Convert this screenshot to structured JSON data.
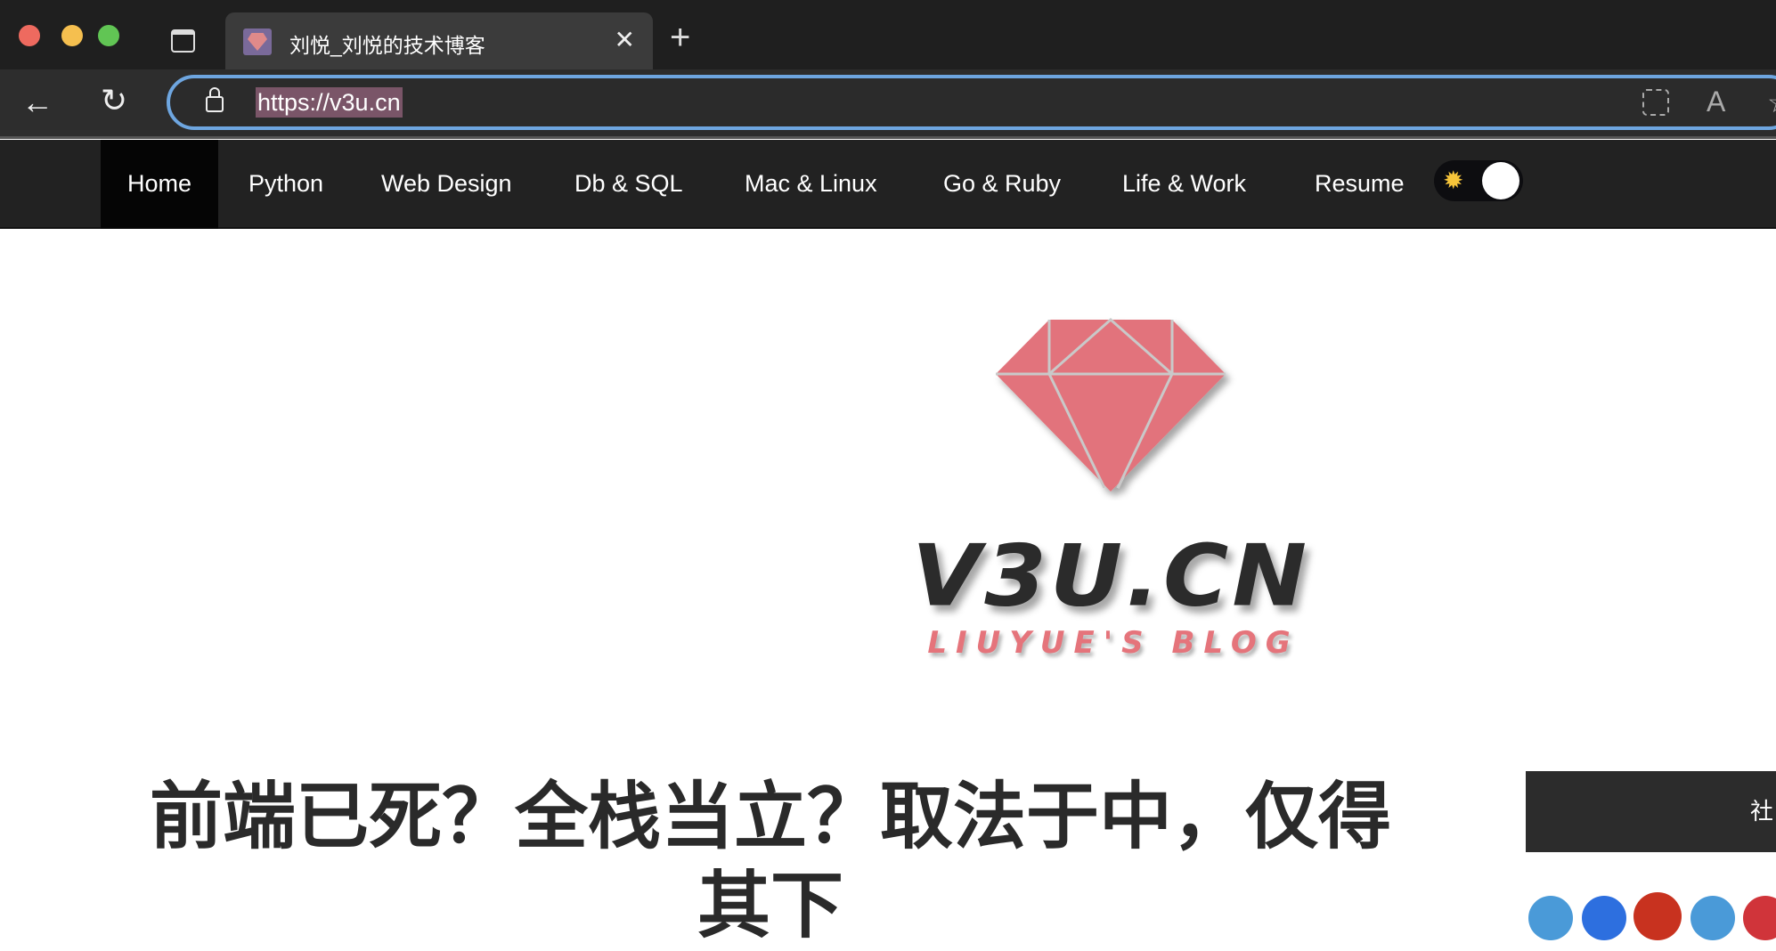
{
  "browser": {
    "tab_title": "刘悦_刘悦的技术博客",
    "url": "https://v3u.cn",
    "icons": [
      "sidebar-toggle-icon",
      "favicon",
      "close-icon",
      "new-tab-icon",
      "back-icon",
      "reload-icon",
      "lock-icon",
      "app-grid-icon",
      "read-aloud-icon",
      "favorite-icon"
    ]
  },
  "nav": {
    "items": [
      "Home",
      "Python",
      "Web Design",
      "Db & SQL",
      "Mac & Linux",
      "Go & Ruby",
      "Life & Work",
      "Resume"
    ],
    "active": "Home",
    "theme_toggle": "light"
  },
  "logo": {
    "main": "V3U.CN",
    "sub": "LIUYUE'S BLOG",
    "color": "#e5747b"
  },
  "post": {
    "title": "前端已死？全栈当立？取法于中，仅得其下"
  },
  "sidebar": {
    "box_title": "社",
    "social_colors": [
      "#4a9ad8",
      "#2d6fdf",
      "#c8321f",
      "#4a9ad8",
      "#d0343a"
    ]
  }
}
